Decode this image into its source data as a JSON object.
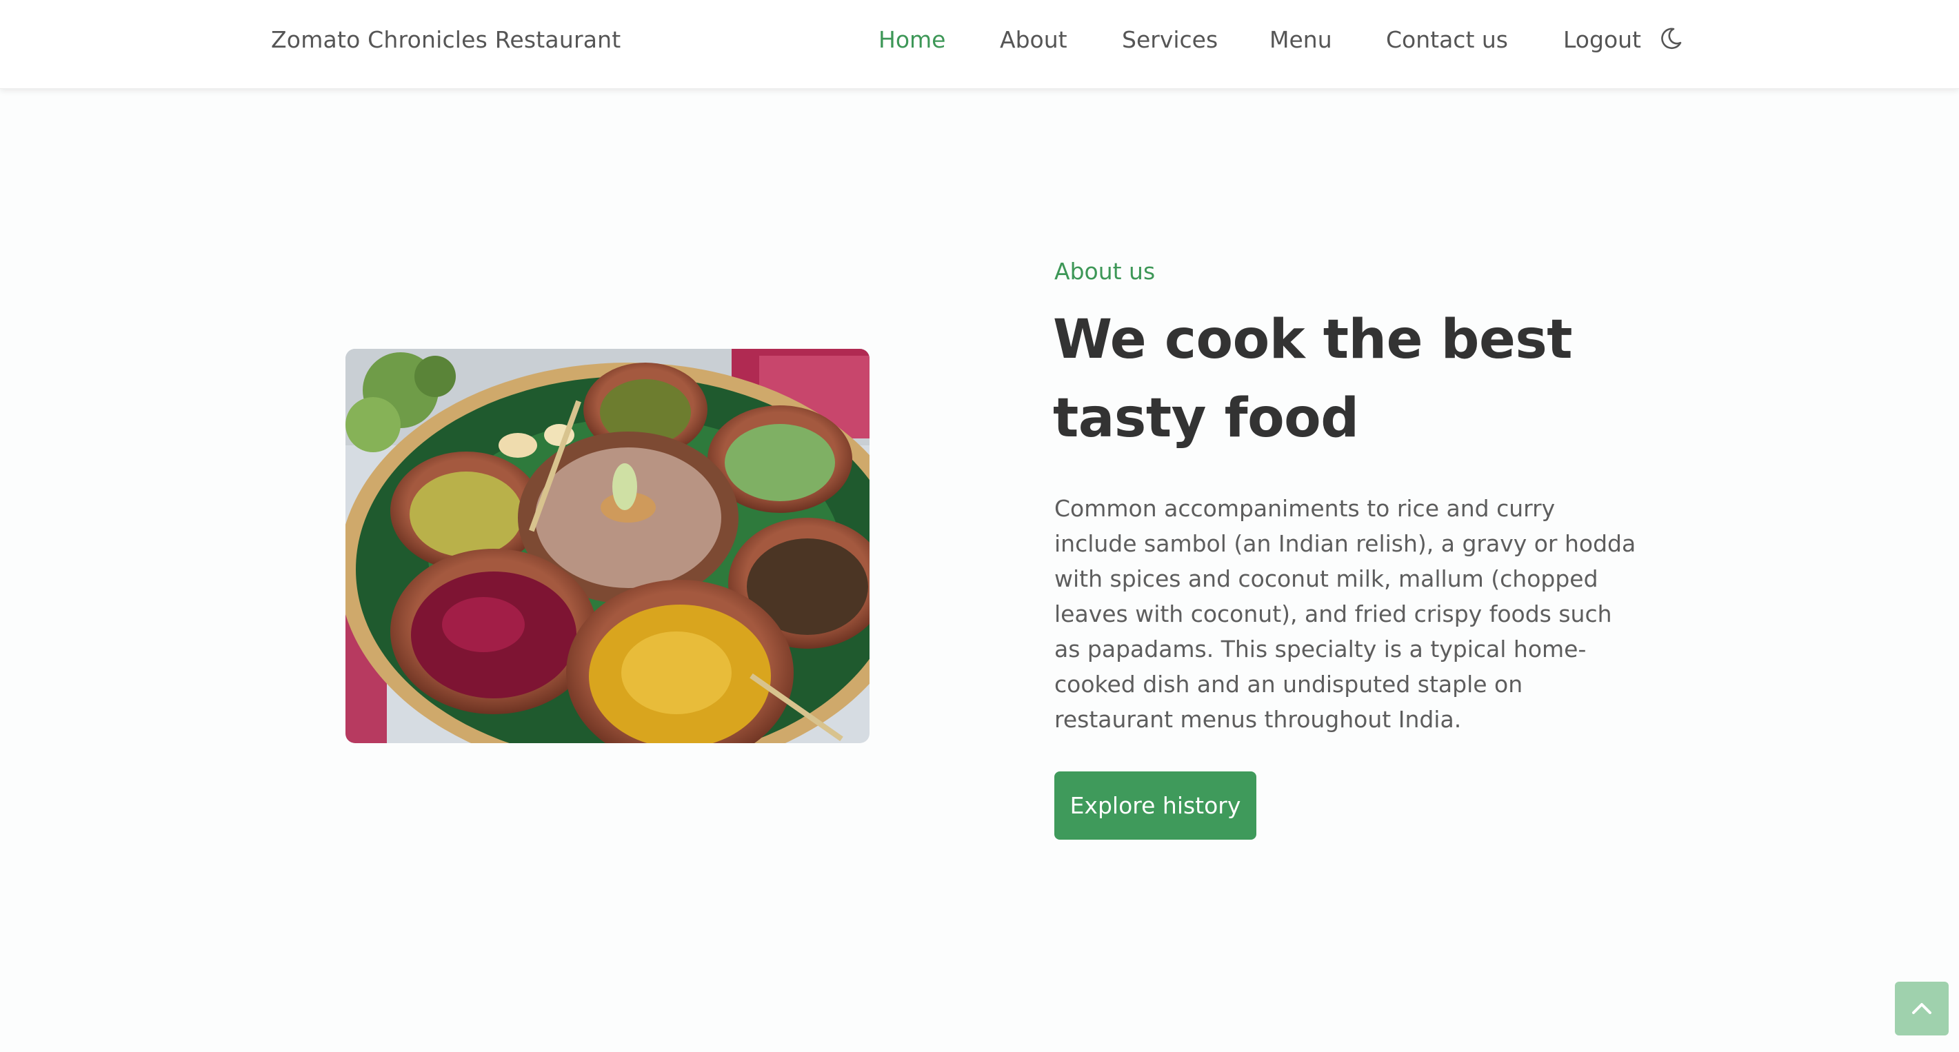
{
  "header": {
    "brand": "Zomato Chronicles Restaurant",
    "nav": [
      {
        "label": "Home",
        "active": true
      },
      {
        "label": "About",
        "active": false
      },
      {
        "label": "Services",
        "active": false
      },
      {
        "label": "Menu",
        "active": false
      },
      {
        "label": "Contact us",
        "active": false
      },
      {
        "label": "Logout",
        "active": false
      }
    ],
    "theme_toggle_icon": "moon-icon"
  },
  "about": {
    "eyebrow": "About us",
    "headline_line1": "We cook the best",
    "headline_line2": "tasty food",
    "body": "Common accompaniments to rice and curry include sambol (an Indian relish), a gravy or hodda with spices and coconut milk, mallum (chopped leaves with coconut), and fried crispy foods such as papadams. This specialty is a typical home-cooked dish and an undisputed staple on restaurant menus throughout India.",
    "cta_label": "Explore history",
    "image_alt": "food-platter-image"
  },
  "back_to_top_icon": "chevron-up-icon",
  "colors": {
    "accent": "#3d9757",
    "text_dark": "#333333",
    "text_muted": "#555555",
    "background": "#fcfdfd",
    "back_to_top": "#9fd1ad"
  }
}
